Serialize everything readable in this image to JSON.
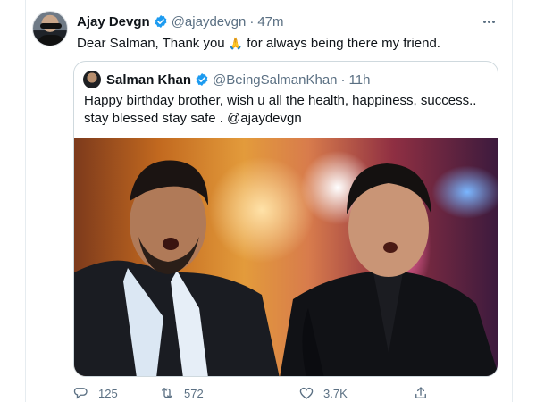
{
  "tweet": {
    "author_name": "Ajay Devgn",
    "author_handle": "@ajaydevgn",
    "separator": "·",
    "time": "47m",
    "text_before_emoji": "Dear Salman, Thank you",
    "emoji": "🙏",
    "text_after_emoji": "for always being there my friend."
  },
  "quote": {
    "author_name": "Salman Khan",
    "author_handle": "@BeingSalmanKhan",
    "separator": "·",
    "time": "11h",
    "text": "Happy  birthday brother, wish u all the health, happiness, success.. stay blessed stay safe . @ajaydevgn"
  },
  "actions": {
    "reply_count": "125",
    "retweet_count": "572",
    "like_count": "3.7K"
  },
  "colors": {
    "verified": "#1d9bf0",
    "muted_text": "#5b7083",
    "border": "#cfd9de"
  },
  "icons": {
    "verified": "verified-badge-icon",
    "more": "more-dots-icon",
    "reply": "reply-icon",
    "retweet": "retweet-icon",
    "like": "heart-icon",
    "share": "share-icon"
  }
}
